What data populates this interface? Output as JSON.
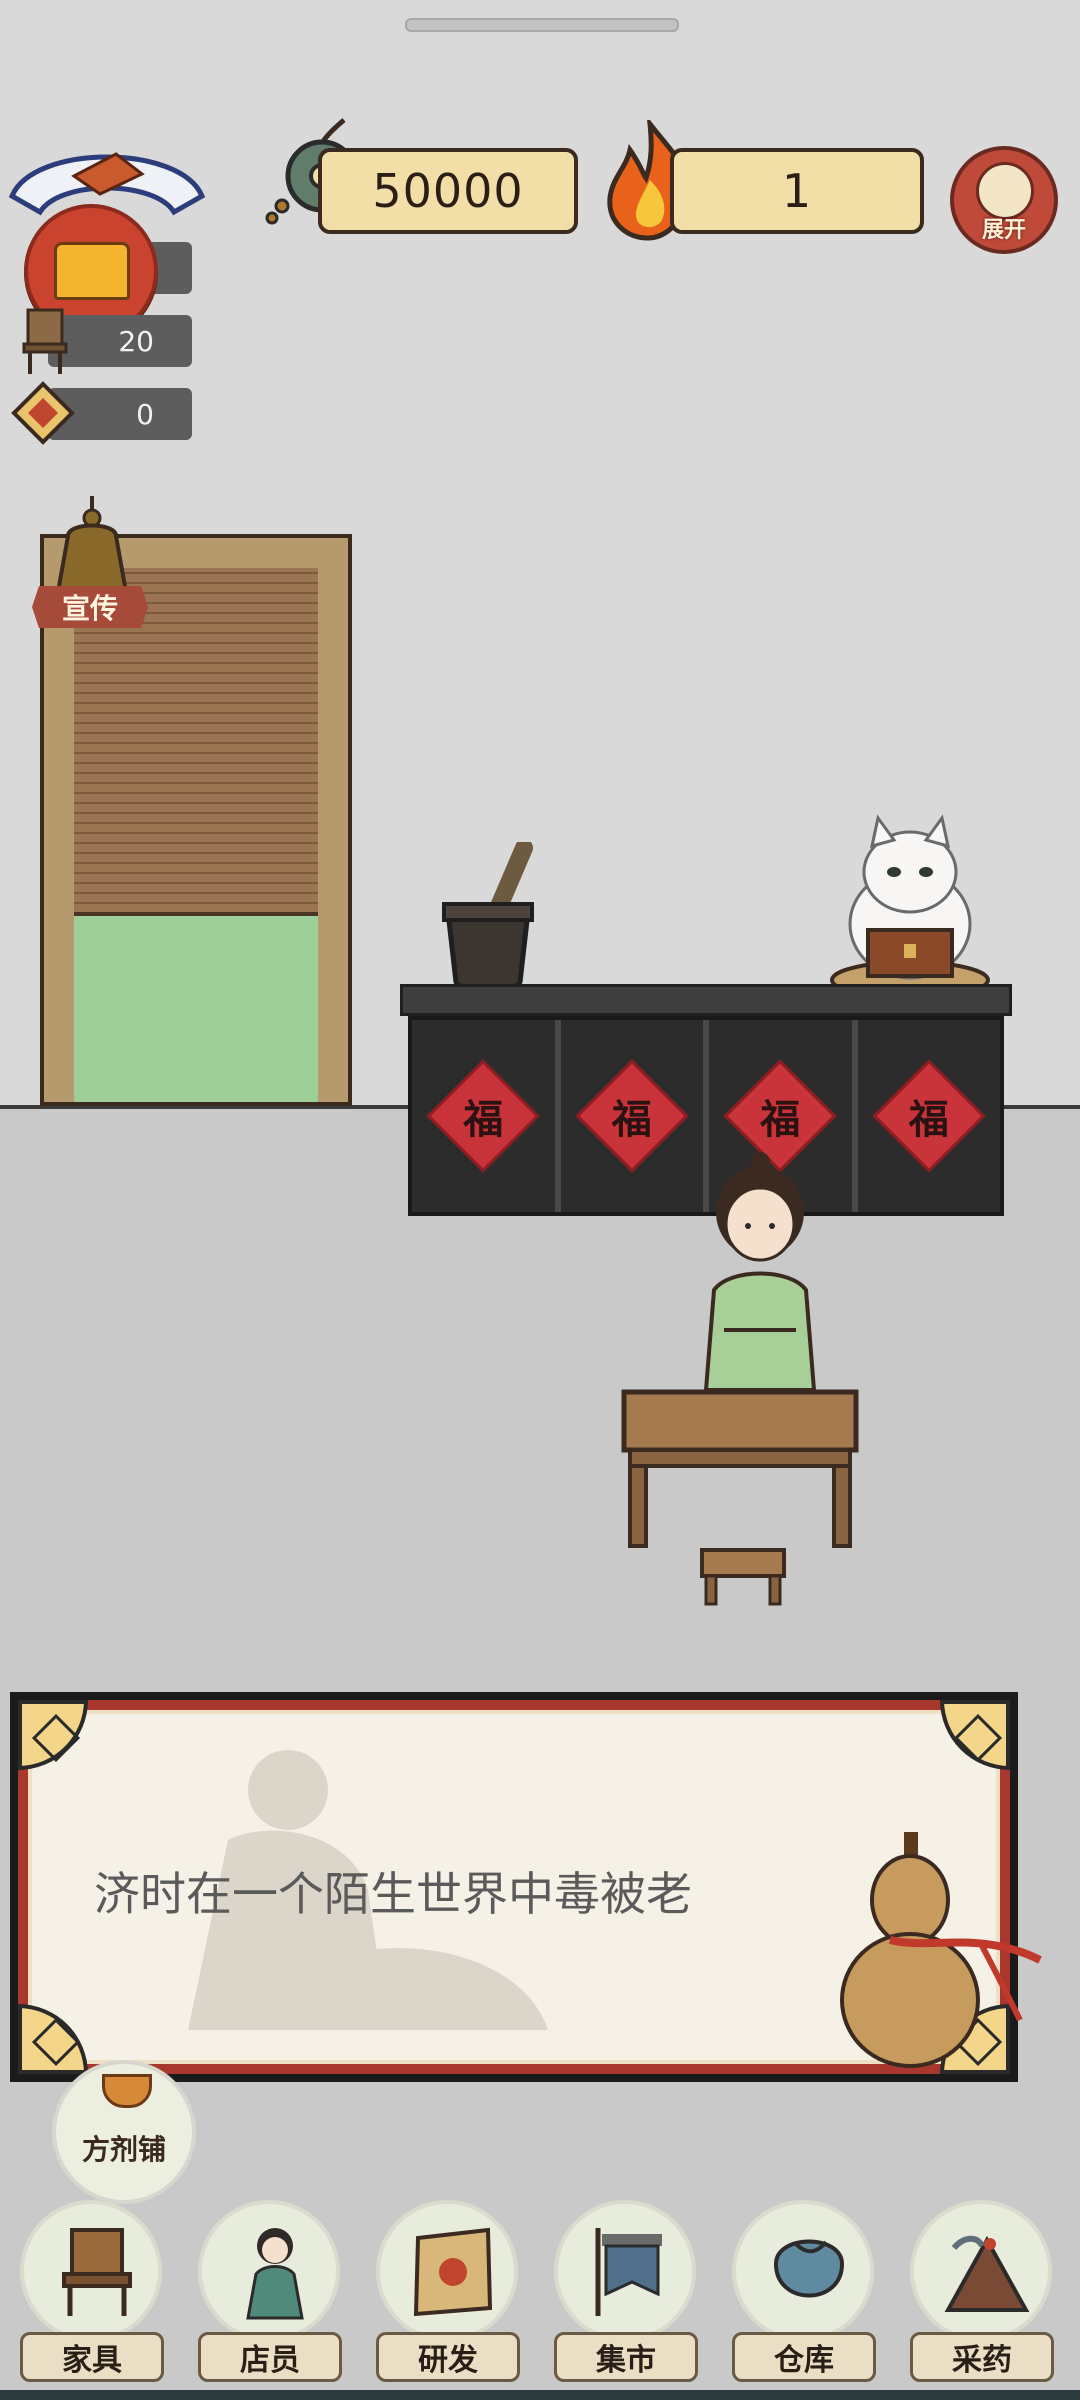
{
  "hud": {
    "coins": "50000",
    "fire": "1",
    "expand_label": "展开"
  },
  "stats": {
    "chest_count": "",
    "chair_count": "20",
    "diamond_count": "0"
  },
  "door": {
    "promo_label": "宣传"
  },
  "dialog": {
    "text": "济时在一个陌生世界中毒被老"
  },
  "shop": {
    "label": "方剂铺"
  },
  "nav": {
    "items": [
      {
        "label": "家具",
        "icon": "chair-icon"
      },
      {
        "label": "店员",
        "icon": "staff-icon"
      },
      {
        "label": "研发",
        "icon": "research-icon"
      },
      {
        "label": "集市",
        "icon": "market-icon"
      },
      {
        "label": "仓库",
        "icon": "warehouse-icon"
      },
      {
        "label": "采药",
        "icon": "herb-icon"
      }
    ]
  },
  "counter": {
    "panel_glyph": "福"
  },
  "colors": {
    "accent_red": "#a8382d",
    "bar_fill": "#f2dfa8",
    "wall": "#d9d9d9",
    "floor": "#c9c9c9"
  }
}
